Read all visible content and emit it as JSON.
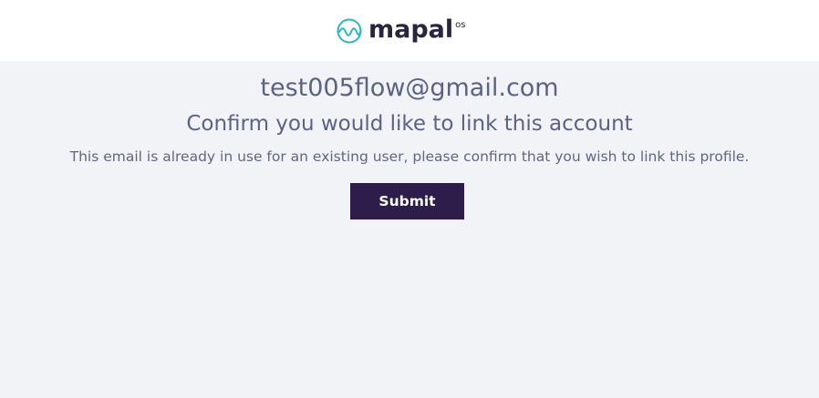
{
  "header": {
    "logo": {
      "icon": "mapal-wave-icon",
      "wordmark": "mapal",
      "suffix": "os",
      "accent_color": "#2bb7be",
      "text_color": "#2a2440"
    }
  },
  "main": {
    "email": "test005flow@gmail.com",
    "heading": "Confirm you would like to link this account",
    "description": "This email is already in use for an existing user, please confirm that you wish to link this profile.",
    "submit_label": "Submit"
  },
  "colors": {
    "page_background": "#f2f3f7",
    "header_background": "#ffffff",
    "text": "#5a6384",
    "button": "#2e1c4b",
    "button_text": "#ffffff"
  }
}
